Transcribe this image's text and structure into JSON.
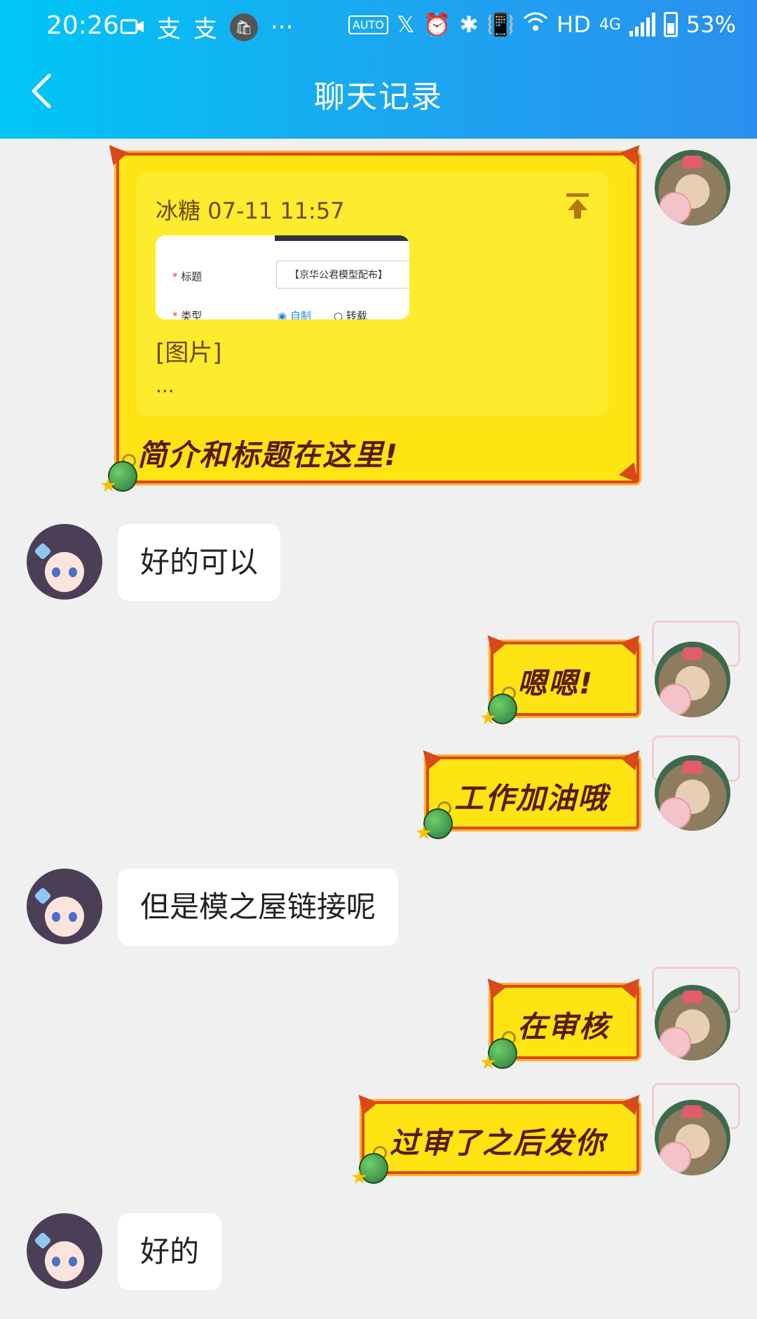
{
  "status_bar": {
    "time": "20:26",
    "network": "HD",
    "net_type": "4G",
    "battery": "53%",
    "auto_label": "AUTO"
  },
  "header": {
    "title": "聊天记录"
  },
  "messages": [
    {
      "side": "right",
      "type": "quote",
      "quote_meta": "冰糖 07-11 11:57",
      "thumb": {
        "row1_label": "标题",
        "row1_value": "【京华公君模型配布】",
        "row2_label": "类型",
        "option1": "自制",
        "option2": "转载"
      },
      "image_label": "[图片]",
      "ellipsis": "...",
      "text": "简介和标题在这里!"
    },
    {
      "side": "left",
      "text": "好的可以"
    },
    {
      "side": "right",
      "text": "嗯嗯!"
    },
    {
      "side": "right",
      "text": "工作加油哦"
    },
    {
      "side": "left",
      "text": "但是模之屋链接呢"
    },
    {
      "side": "right",
      "text": "在审核"
    },
    {
      "side": "right",
      "text": "过审了之后发你"
    },
    {
      "side": "left",
      "text": "好的"
    }
  ],
  "colors": {
    "header_start": "#00c6f5",
    "header_end": "#2a90ef",
    "bubble_yellow": "#ffe414",
    "bubble_border": "#d84a1a",
    "bubble_text": "#5a1a0a",
    "background": "#f0f0f0"
  },
  "icons": [
    "back-arrow-icon",
    "upload-top-icon",
    "grenade-sticker-icon"
  ]
}
